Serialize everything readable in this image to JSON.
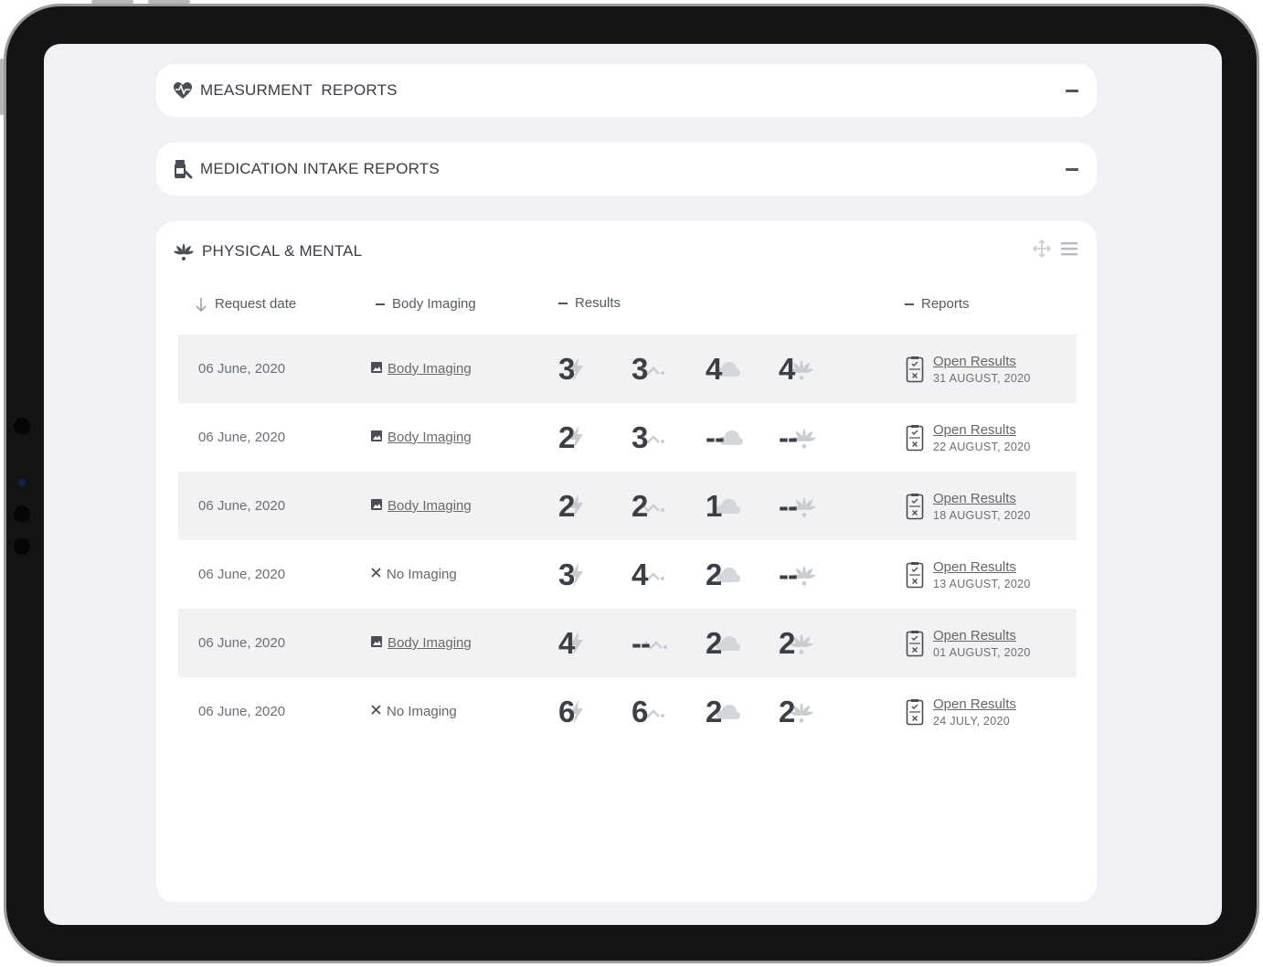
{
  "sections": {
    "measurement": {
      "title": "MEASURMENT  REPORTS"
    },
    "medication": {
      "title": "MEDICATION INTAKE REPORTS"
    },
    "physical": {
      "title": "PHYSICAL & MENTAL"
    }
  },
  "table": {
    "headers": {
      "request_date": "Request date",
      "body_imaging": "Body Imaging",
      "results": "Results",
      "reports": "Reports"
    },
    "rows": [
      {
        "date": "06 June, 2020",
        "imaging": "Body Imaging",
        "has_imaging": true,
        "r1": "3",
        "r2": "3",
        "r3": "4",
        "r4": "4",
        "report_link": "Open Results",
        "report_date": "31 AUGUST, 2020"
      },
      {
        "date": "06 June, 2020",
        "imaging": "Body Imaging",
        "has_imaging": true,
        "r1": "2",
        "r2": "3",
        "r3": "--",
        "r4": "--",
        "report_link": "Open Results",
        "report_date": "22 AUGUST, 2020"
      },
      {
        "date": "06 June, 2020",
        "imaging": "Body Imaging",
        "has_imaging": true,
        "r1": "2",
        "r2": "2",
        "r3": "1",
        "r4": "--",
        "report_link": "Open Results",
        "report_date": "18 AUGUST, 2020"
      },
      {
        "date": "06 June, 2020",
        "imaging": "No Imaging",
        "has_imaging": false,
        "r1": "3",
        "r2": "4",
        "r3": "2",
        "r4": "--",
        "report_link": "Open Results",
        "report_date": "13 AUGUST, 2020"
      },
      {
        "date": "06 June, 2020",
        "imaging": "Body Imaging",
        "has_imaging": true,
        "r1": "4",
        "r2": "--",
        "r3": "2",
        "r4": "2",
        "report_link": "Open Results",
        "report_date": "01 AUGUST, 2020"
      },
      {
        "date": "06 June, 2020",
        "imaging": "No Imaging",
        "has_imaging": false,
        "r1": "6",
        "r2": "6",
        "r3": "2",
        "r4": "2",
        "report_link": "Open Results",
        "report_date": "24 JULY, 2020"
      }
    ]
  },
  "icons": {
    "measurement": "heart-pulse-icon",
    "medication": "pill-bottle-icon",
    "physical": "lotus-icon",
    "result1": "lightning-icon",
    "result2": "trend-icon",
    "result3": "cloud-icon",
    "result4": "lotus-icon",
    "report": "clipboard-icon"
  },
  "colors": {
    "text": "#3c3f45",
    "icon_light": "#c9ccd1",
    "row_shade": "#f2f2f4",
    "background": "#f0f1f4"
  }
}
